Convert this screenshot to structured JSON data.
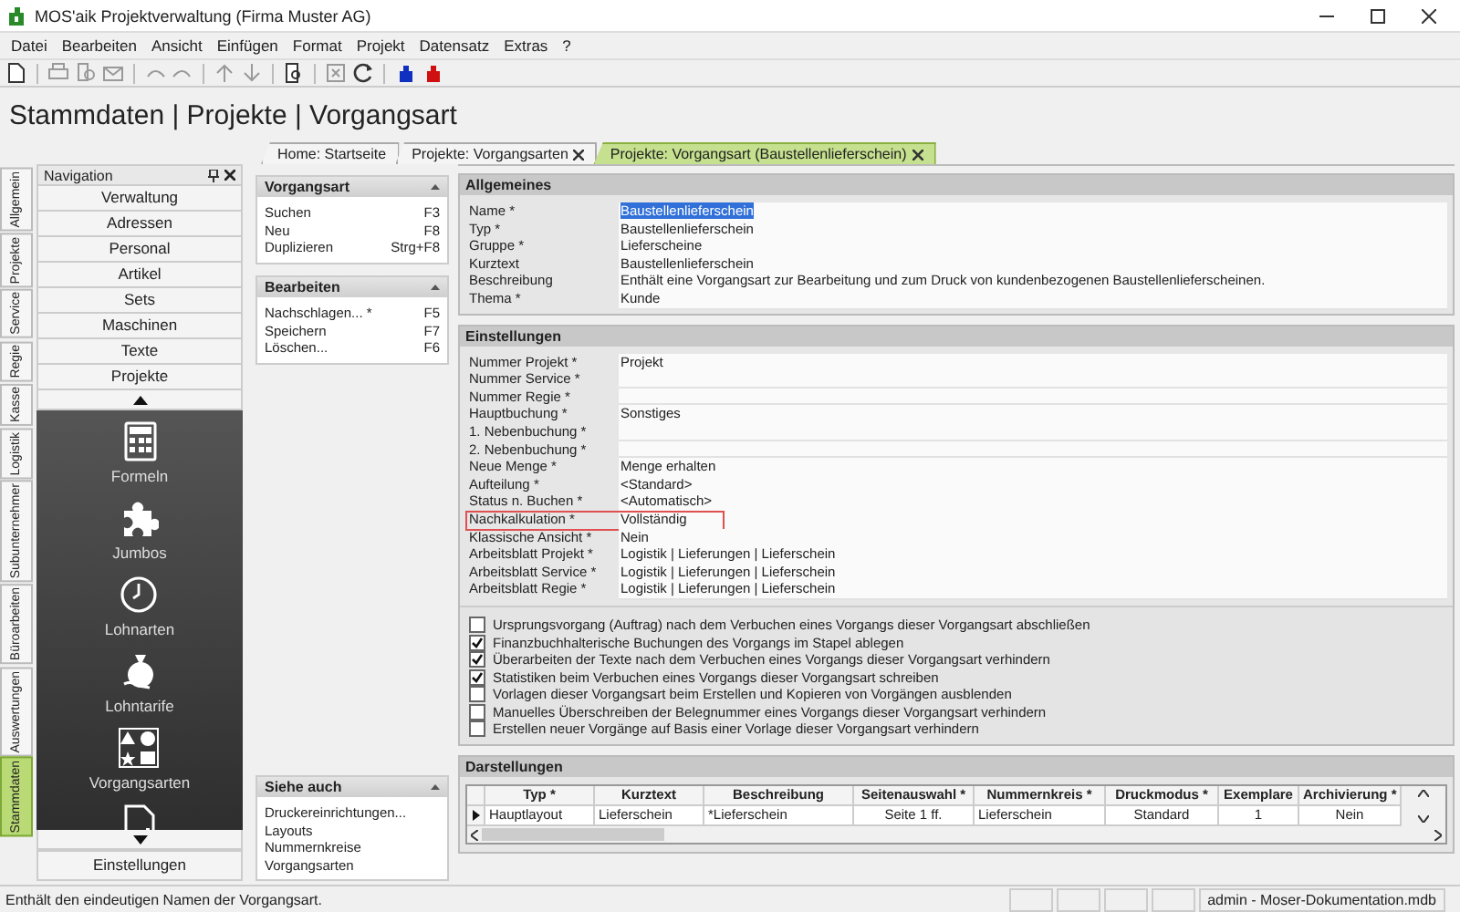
{
  "window": {
    "title": "MOS'aik Projektverwaltung (Firma Muster AG)"
  },
  "menu": [
    "Datei",
    "Bearbeiten",
    "Ansicht",
    "Einfügen",
    "Format",
    "Projekt",
    "Datensatz",
    "Extras",
    "?"
  ],
  "breadcrumb": "Stammdaten | Projekte | Vorgangsart",
  "tabs": [
    {
      "label": "Home: Startseite",
      "closable": false,
      "selected": false
    },
    {
      "label": "Projekte: Vorgangsarten",
      "closable": true,
      "selected": false
    },
    {
      "label": "Projekte: Vorgangsart (Baustellenlieferschein)",
      "closable": true,
      "selected": true
    }
  ],
  "side_tabs": [
    {
      "label": "Allgemein",
      "selected": false
    },
    {
      "label": "Projekte",
      "selected": false
    },
    {
      "label": "Service",
      "selected": false
    },
    {
      "label": "Regie",
      "selected": false
    },
    {
      "label": "Kasse",
      "selected": false
    },
    {
      "label": "Logistik",
      "selected": false
    },
    {
      "label": "Subunternehmer",
      "selected": false
    },
    {
      "label": "Büroarbeiten",
      "selected": false
    },
    {
      "label": "Auswertungen",
      "selected": false
    },
    {
      "label": "Stammdaten",
      "selected": true
    }
  ],
  "navigation": {
    "title": "Navigation",
    "groups": [
      "Verwaltung",
      "Adressen",
      "Personal",
      "Artikel",
      "Sets",
      "Maschinen",
      "Texte",
      "Projekte"
    ],
    "items": [
      {
        "kind": "calculator",
        "label": "Formeln"
      },
      {
        "kind": "puzzle",
        "label": "Jumbos"
      },
      {
        "kind": "clock",
        "label": "Lohnarten"
      },
      {
        "kind": "money-bag",
        "label": "Lohntarife"
      },
      {
        "kind": "shapes",
        "label": "Vorgangsarten"
      },
      {
        "kind": "document-plus"
      }
    ],
    "footer": "Einstellungen"
  },
  "task_panels": [
    {
      "title": "Vorgangsart",
      "actions": [
        {
          "label": "Suchen",
          "shortcut": "F3"
        },
        {
          "label": "Neu",
          "shortcut": "F8"
        },
        {
          "label": "Duplizieren",
          "shortcut": "Strg+F8"
        }
      ]
    },
    {
      "title": "Bearbeiten",
      "actions": [
        {
          "label": "Nachschlagen... *",
          "shortcut": "F5"
        },
        {
          "label": "Speichern",
          "shortcut": "F7"
        },
        {
          "label": "Löschen...",
          "shortcut": "F6"
        }
      ]
    }
  ],
  "see_also": {
    "title": "Siehe auch",
    "links": [
      "Druckereinrichtungen...",
      "Layouts",
      "Nummernkreise",
      "Vorgangsarten"
    ]
  },
  "sections": [
    {
      "title": "Allgemeines",
      "fields": [
        {
          "label": "Name *",
          "value": "Baustellenlieferschein",
          "selected": true,
          "highlighted": false
        },
        {
          "label": "Typ *",
          "value": "Baustellenlieferschein",
          "selected": false,
          "highlighted": false
        },
        {
          "label": "Gruppe *",
          "value": "Lieferscheine",
          "selected": false,
          "highlighted": false
        },
        {
          "label": "Kurztext",
          "value": "Baustellenlieferschein",
          "selected": false,
          "highlighted": false
        },
        {
          "label": "Beschreibung",
          "value": "Enthält eine Vorgangsart zur Bearbeitung und zum Druck von kundenbezogenen Baustellenlieferscheinen.",
          "selected": false,
          "highlighted": false
        },
        {
          "label": "Thema *",
          "value": "Kunde",
          "selected": false,
          "highlighted": false
        }
      ]
    },
    {
      "title": "Einstellungen",
      "fields": [
        {
          "label": "Nummer Projekt *",
          "value": "Projekt",
          "selected": false,
          "highlighted": false
        },
        {
          "label": "Nummer Service *",
          "selected": false,
          "highlighted": false
        },
        {
          "label": "Nummer Regie *",
          "selected": false,
          "highlighted": false
        },
        {
          "label": "Hauptbuchung *",
          "value": "Sonstiges",
          "selected": false,
          "highlighted": false
        },
        {
          "label": "1. Nebenbuchung *",
          "selected": false,
          "highlighted": false
        },
        {
          "label": "2. Nebenbuchung *",
          "selected": false,
          "highlighted": false
        },
        {
          "label": "Neue Menge *",
          "value": "Menge erhalten",
          "selected": false,
          "highlighted": false
        },
        {
          "label": "Aufteilung *",
          "value": "<Standard>",
          "selected": false,
          "highlighted": false
        },
        {
          "label": "Status n. Buchen *",
          "value": "<Automatisch>",
          "selected": false,
          "highlighted": false
        },
        {
          "label": "Nachkalkulation *",
          "value": "Vollständig",
          "selected": false,
          "highlighted": true
        },
        {
          "label": "Klassische Ansicht *",
          "value": "Nein",
          "selected": false,
          "highlighted": false
        },
        {
          "label": "Arbeitsblatt Projekt *",
          "value": "Logistik | Lieferungen | Lieferschein",
          "selected": false,
          "highlighted": false
        },
        {
          "label": "Arbeitsblatt Service *",
          "value": "Logistik | Lieferungen | Lieferschein",
          "selected": false,
          "highlighted": false
        },
        {
          "label": "Arbeitsblatt Regie *",
          "value": "Logistik | Lieferungen | Lieferschein",
          "selected": false,
          "highlighted": false
        }
      ],
      "options": [
        {
          "label": "Ursprungsvorgang (Auftrag) nach dem Verbuchen eines Vorgangs dieser Vorgangsart abschließen",
          "checked": false
        },
        {
          "label": "Finanzbuchhalterische Buchungen des Vorgangs im Stapel ablegen",
          "checked": true
        },
        {
          "label": "Überarbeiten der Texte nach dem Verbuchen eines Vorgangs dieser Vorgangsart verhindern",
          "checked": true
        },
        {
          "label": "Statistiken beim Verbuchen eines Vorgangs dieser Vorgangsart schreiben",
          "checked": true
        },
        {
          "label": "Vorlagen dieser Vorgangsart beim Erstellen und Kopieren von Vorgängen ausblenden",
          "checked": false
        },
        {
          "label": "Manuelles Überschreiben der Belegnummer eines Vorgangs dieser Vorgangsart verhindern",
          "checked": false
        },
        {
          "label": "Erstellen neuer Vorgänge auf Basis einer Vorlage dieser Vorgangsart verhindern",
          "checked": false
        }
      ]
    }
  ],
  "darstellungen": {
    "title": "Darstellungen",
    "columns": [
      "Typ *",
      "Kurztext",
      "Beschreibung",
      "Seitenauswahl *",
      "Nummernkreis *",
      "Druckmodus *",
      "Exemplare",
      "Archivierung *"
    ],
    "rows": [
      {
        "current": true,
        "cells": [
          "Hauptlayout",
          "Lieferschein",
          "*Lieferschein",
          "Seite 1 ff.",
          "Lieferschein",
          "Standard",
          "1",
          "Nein"
        ]
      }
    ]
  },
  "status_bar": {
    "message": "Enthält den eindeutigen Namen der Vorgangsart.",
    "info": "admin - Moser-Dokumentation.mdb"
  }
}
